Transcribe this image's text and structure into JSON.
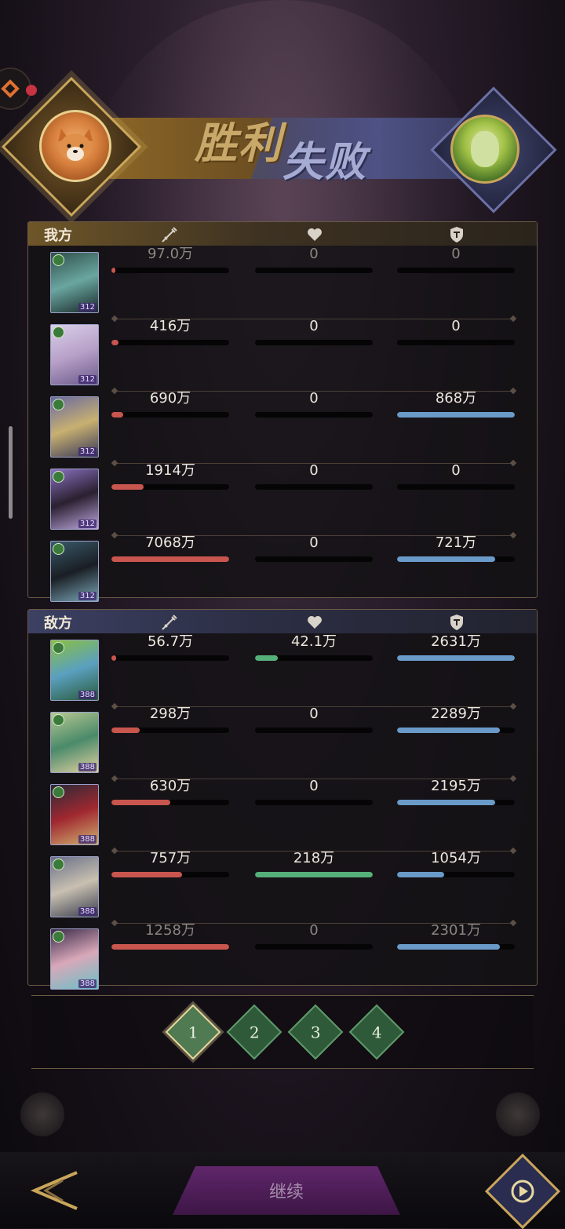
{
  "banner": {
    "victory": "胜利",
    "defeat": "失败"
  },
  "panels": {
    "ours": {
      "label": "我方",
      "rows": [
        {
          "dmg": "97.0万",
          "dmg_pct": 0.02,
          "heal": "0",
          "heal_pct": 0,
          "tank": "0",
          "tank_pct": 0,
          "level": "312",
          "art": [
            "#2f4f4a",
            "#6aa6a0",
            "#1a2a2a"
          ]
        },
        {
          "dmg": "416万",
          "dmg_pct": 0.06,
          "heal": "0",
          "heal_pct": 0,
          "tank": "0",
          "tank_pct": 0,
          "level": "312",
          "art": [
            "#d8d0e8",
            "#b8a0c8",
            "#6a5a8a"
          ]
        },
        {
          "dmg": "690万",
          "dmg_pct": 0.1,
          "heal": "0",
          "heal_pct": 0,
          "tank": "868万",
          "tank_pct": 1.0,
          "level": "312",
          "art": [
            "#6a6aa0",
            "#c8b070",
            "#3a3a5a"
          ]
        },
        {
          "dmg": "1914万",
          "dmg_pct": 0.27,
          "heal": "0",
          "heal_pct": 0,
          "tank": "0",
          "tank_pct": 0,
          "level": "312",
          "art": [
            "#8a70c0",
            "#2a2030",
            "#c0a8e0"
          ]
        },
        {
          "dmg": "7068万",
          "dmg_pct": 1.0,
          "heal": "0",
          "heal_pct": 0,
          "tank": "721万",
          "tank_pct": 0.83,
          "level": "312",
          "art": [
            "#3a5a6a",
            "#1a1e24",
            "#7aa8b8"
          ]
        }
      ]
    },
    "enemy": {
      "label": "敌方",
      "rows": [
        {
          "dmg": "56.7万",
          "dmg_pct": 0.04,
          "heal": "42.1万",
          "heal_pct": 0.19,
          "tank": "2631万",
          "tank_pct": 1.0,
          "level": "388",
          "art": [
            "#8ac040",
            "#5aa0c0",
            "#2a5a3a"
          ]
        },
        {
          "dmg": "298万",
          "dmg_pct": 0.24,
          "heal": "0",
          "heal_pct": 0,
          "tank": "2289万",
          "tank_pct": 0.87,
          "level": "388",
          "art": [
            "#b8c890",
            "#4a8a6a",
            "#e0d0a0"
          ]
        },
        {
          "dmg": "630万",
          "dmg_pct": 0.5,
          "heal": "0",
          "heal_pct": 0,
          "tank": "2195万",
          "tank_pct": 0.83,
          "level": "388",
          "art": [
            "#2a2a38",
            "#a02830",
            "#d0b070"
          ]
        },
        {
          "dmg": "757万",
          "dmg_pct": 0.6,
          "heal": "218万",
          "heal_pct": 1.0,
          "tank": "1054万",
          "tank_pct": 0.4,
          "level": "388",
          "art": [
            "#6a7088",
            "#c8c0b0",
            "#3a3e50"
          ]
        },
        {
          "dmg": "1258万",
          "dmg_pct": 1.0,
          "heal": "0",
          "heal_pct": 0,
          "tank": "2301万",
          "tank_pct": 0.87,
          "level": "388",
          "art": [
            "#3a2a4a",
            "#d8a8b8",
            "#6ac0c8"
          ]
        }
      ]
    }
  },
  "pages": [
    "1",
    "2",
    "3",
    "4"
  ],
  "active_page": "1",
  "bottom": {
    "main_button": "继续"
  },
  "colors": {
    "damage": "#c8564e",
    "heal": "#56b07a",
    "tank": "#6a9ac8",
    "gold": "#c9a65a"
  },
  "icons": {
    "damage": "sword-icon",
    "heal": "heart-icon",
    "tank": "shield-icon",
    "back": "back-arrow-icon",
    "replay": "replay-icon"
  }
}
